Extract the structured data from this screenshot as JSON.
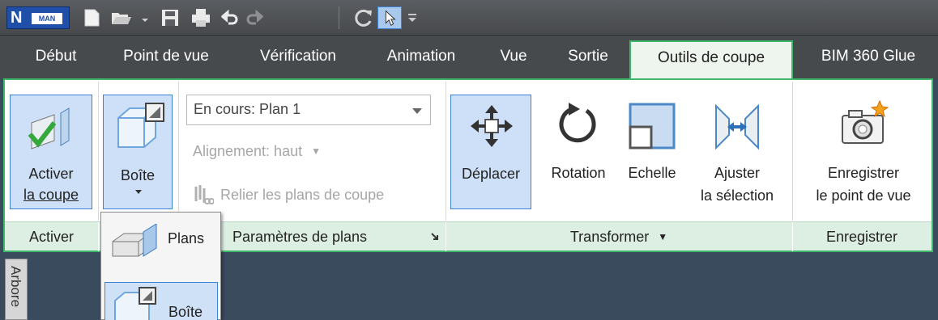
{
  "qat": {
    "logo_letter": "N",
    "logo_text": "MAN",
    "icons": [
      "new-file-icon",
      "open-folder-icon",
      "save-icon",
      "print-icon",
      "undo-icon",
      "redo-icon",
      "refresh-icon",
      "select-cursor-icon",
      "customize-dropdown-icon"
    ]
  },
  "tabs": [
    {
      "label": "Début"
    },
    {
      "label": "Point de vue"
    },
    {
      "label": "Vérification"
    },
    {
      "label": "Animation"
    },
    {
      "label": "Vue"
    },
    {
      "label": "Sortie"
    },
    {
      "label": "Outils de coupe"
    },
    {
      "label": "BIM 360 Glue"
    }
  ],
  "ribbon": {
    "activer": {
      "button_line1": "Activer",
      "button_line2": "la coupe",
      "panel_label": "Activer"
    },
    "mode": {
      "button_label": "Boîte"
    },
    "parametres": {
      "combo_value": "En cours: Plan 1",
      "alignment_label": "Alignement: haut",
      "link_label": "Relier les plans de coupe",
      "panel_label": "Paramètres de plans"
    },
    "transformer": {
      "move_label": "Déplacer",
      "rotate_label": "Rotation",
      "scale_label": "Echelle",
      "fit_line1": "Ajuster",
      "fit_line2": "la sélection",
      "panel_label": "Transformer"
    },
    "enregistrer": {
      "button_line1": "Enregistrer",
      "button_line2": "le point de vue",
      "panel_label": "Enregistrer"
    }
  },
  "menu": {
    "items": [
      {
        "label": "Plans"
      },
      {
        "label": "Boîte"
      }
    ]
  },
  "sidetab": {
    "label": "Arbore"
  },
  "colors": {
    "accent_green": "#3fb86b",
    "selection_blue": "#3d82d6",
    "viewport": "#3a4b5e"
  }
}
